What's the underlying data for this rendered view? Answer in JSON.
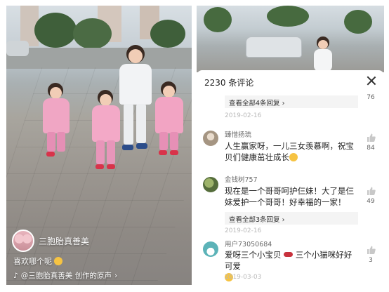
{
  "left_video": {
    "creator_name": "三胞胎真善美",
    "caption": "喜欢哪个呢",
    "music": "@三胞胎真善美 创作的原声",
    "music_arrow": "›",
    "icons": {
      "emoji": "smile-emoji",
      "music": "music-note-icon"
    }
  },
  "comments_sheet": {
    "count_label": "2230 条评论",
    "close_icon": "close-icon",
    "top_partial": {
      "more_label": "查看全部4条回复",
      "date": "2019-02-16",
      "likes": "76"
    },
    "comments": [
      {
        "user": "臻惜扬琉",
        "text": "人生赢家呀，一儿三女羡慕啊，祝宝贝们健康茁壮成长",
        "date": "2019-02-16",
        "likes": "84",
        "avatar_color": "#c6b8a6"
      },
      {
        "user": "金钱树757",
        "text": "现在是一个哥哥呵护仨妹！大了是仨妹爱护一个哥哥！好幸福的一家！",
        "more_label": "查看全部3条回复",
        "date": "2019-02-16",
        "likes": "49",
        "avatar_color": "#6f8f4e"
      },
      {
        "user": "用户73050684",
        "text_a": "爱呀三个小宝贝",
        "text_b": "三个小猫咪好好可爱",
        "date": "2019-03-03",
        "likes": "3",
        "avatar_color": "#79c4c7"
      }
    ]
  }
}
